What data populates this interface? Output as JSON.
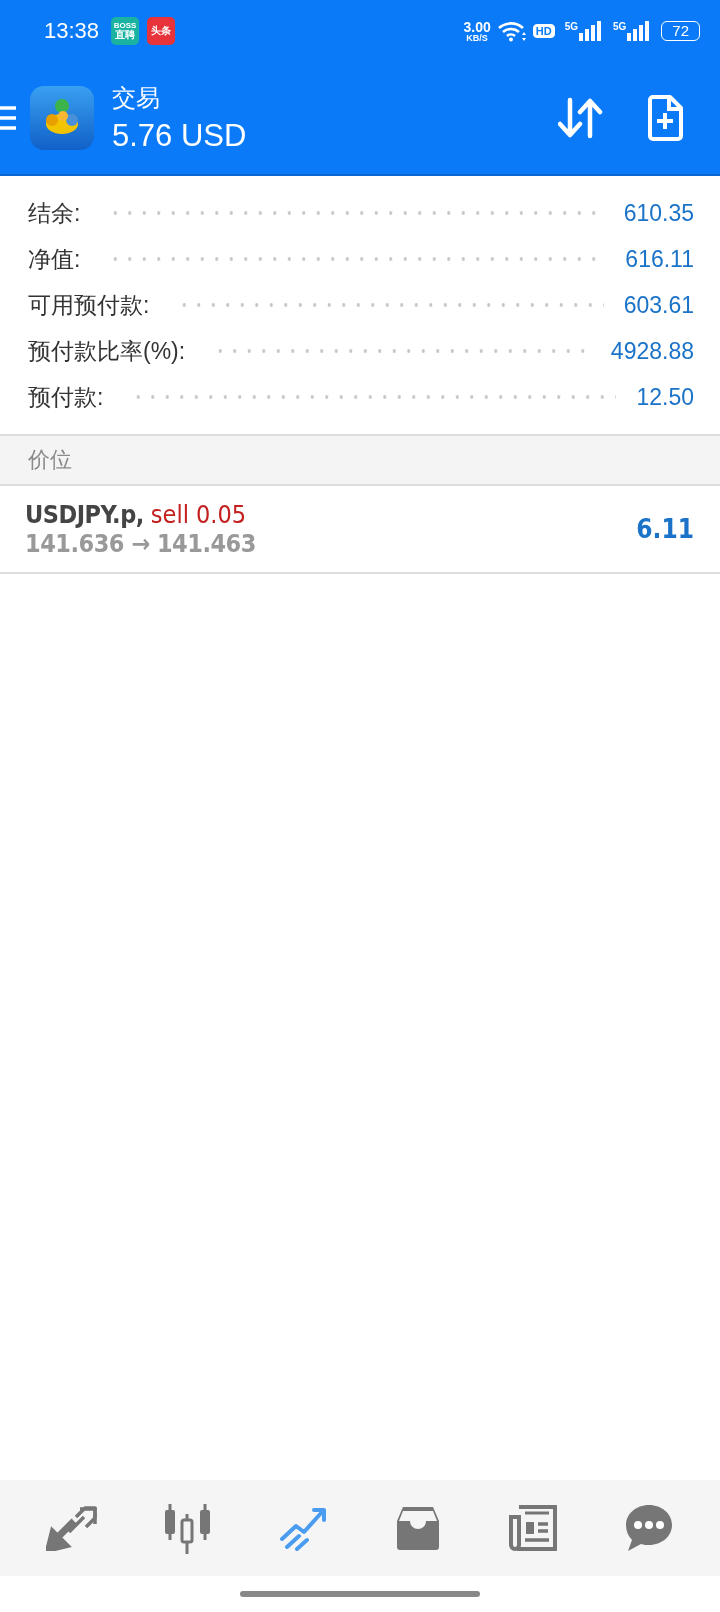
{
  "status_bar": {
    "time": "13:38",
    "app_badges": [
      {
        "kind": "boss",
        "top": "BOSS",
        "bottom": "直聘"
      },
      {
        "kind": "news",
        "label": "头条"
      }
    ],
    "speed": "3.00",
    "speed_unit": "KB/S",
    "hd": "HD",
    "signals": [
      "5G",
      "5G"
    ],
    "battery": "72"
  },
  "header": {
    "title": "交易",
    "subtitle": "5.76 USD"
  },
  "summary": [
    {
      "label": "结余:",
      "value": "610.35"
    },
    {
      "label": "净值:",
      "value": "616.11"
    },
    {
      "label": "可用预付款:",
      "value": "603.61"
    },
    {
      "label": "预付款比率(%):",
      "value": "4928.88"
    },
    {
      "label": "预付款:",
      "value": "12.50"
    }
  ],
  "section_title": "价位",
  "positions": [
    {
      "symbol": "USDJPY.p,",
      "side": "sell 0.05",
      "prices": "141.636 → 141.463",
      "profit": "6.11"
    }
  ],
  "nav": [
    {
      "kind": "trade",
      "selected": false
    },
    {
      "kind": "quotes",
      "selected": false
    },
    {
      "kind": "chart",
      "selected": true
    },
    {
      "kind": "inbox",
      "selected": false
    },
    {
      "kind": "news",
      "selected": false
    },
    {
      "kind": "chat",
      "selected": false
    }
  ]
}
